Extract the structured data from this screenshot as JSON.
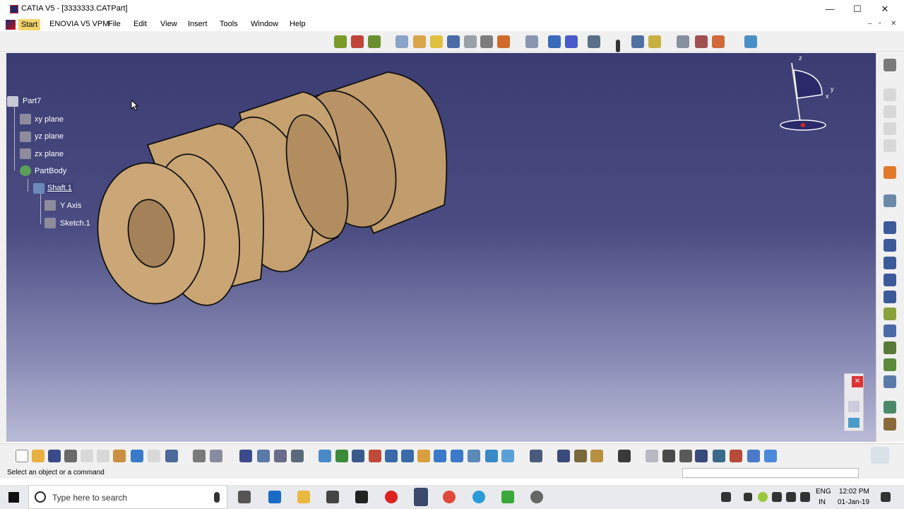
{
  "window": {
    "title": "CATIA V5 - [3333333.CATPart]",
    "minimize_glyph": "—",
    "maximize_glyph": "☐",
    "close_glyph": "✕"
  },
  "menu": {
    "items": [
      {
        "label": "Start"
      },
      {
        "label": "ENOVIA V5 VPM"
      },
      {
        "label": "File"
      },
      {
        "label": "Edit"
      },
      {
        "label": "View"
      },
      {
        "label": "Insert"
      },
      {
        "label": "Tools"
      },
      {
        "label": "Window"
      },
      {
        "label": "Help"
      }
    ],
    "mdi": {
      "minimize": "–",
      "restore": "▫",
      "close": "✕"
    }
  },
  "tree": {
    "root": "Part7",
    "planes": [
      "xy plane",
      "yz plane",
      "zx plane"
    ],
    "body": "PartBody",
    "feature": "Shaft.1",
    "children": [
      "Y Axis",
      "Sketch.1"
    ]
  },
  "compass": {
    "z": "z",
    "y": "y",
    "x": "x"
  },
  "status": {
    "message": "Select an object or a command"
  },
  "taskbar": {
    "search_placeholder": "Type here to search",
    "lang_top": "ENG",
    "lang_bottom": "IN",
    "time": "12:02 PM",
    "date": "01-Jan-19"
  },
  "colors": {
    "part_fill": "#c9a574",
    "viewport_top": "#3a3c72",
    "viewport_bottom": "#b9bad6",
    "start_highlight": "#f2d36b"
  }
}
